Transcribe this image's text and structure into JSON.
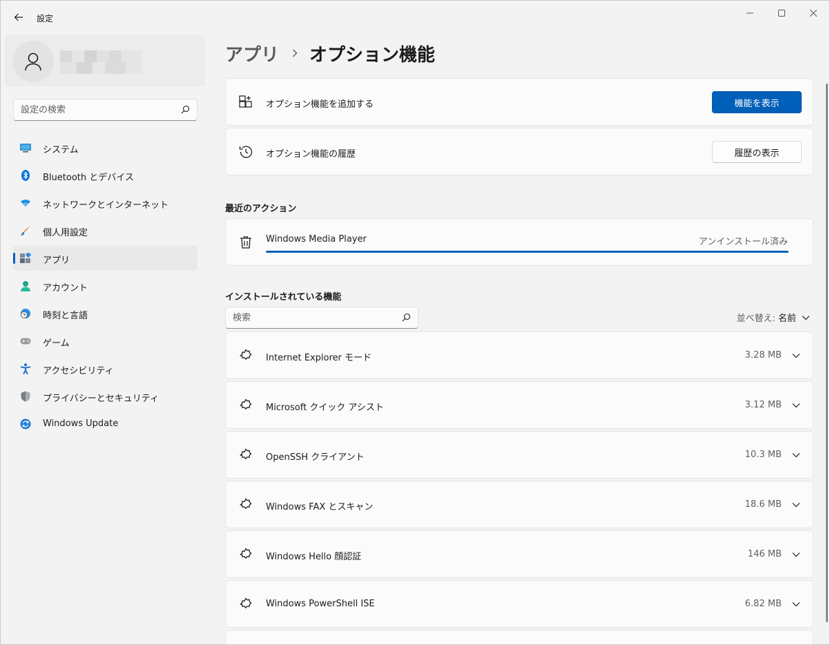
{
  "window": {
    "app_title": "設定"
  },
  "sidebar": {
    "search_placeholder": "設定の検索",
    "items": [
      {
        "label": "システム",
        "icon": "display-icon",
        "active": false
      },
      {
        "label": "Bluetooth とデバイス",
        "icon": "bluetooth-icon",
        "active": false
      },
      {
        "label": "ネットワークとインターネット",
        "icon": "wifi-icon",
        "active": false
      },
      {
        "label": "個人用設定",
        "icon": "brush-icon",
        "active": false
      },
      {
        "label": "アプリ",
        "icon": "apps-icon",
        "active": true
      },
      {
        "label": "アカウント",
        "icon": "person-icon",
        "active": false
      },
      {
        "label": "時刻と言語",
        "icon": "globe-clock-icon",
        "active": false
      },
      {
        "label": "ゲーム",
        "icon": "gamepad-icon",
        "active": false
      },
      {
        "label": "アクセシビリティ",
        "icon": "accessibility-icon",
        "active": false
      },
      {
        "label": "プライバシーとセキュリティ",
        "icon": "shield-icon",
        "active": false
      },
      {
        "label": "Windows Update",
        "icon": "update-icon",
        "active": false
      }
    ]
  },
  "breadcrumb": {
    "parent": "アプリ",
    "current": "オプション機能"
  },
  "add_feature": {
    "label": "オプション機能を追加する",
    "button": "機能を表示"
  },
  "history": {
    "label": "オプション機能の履歴",
    "button": "履歴の表示"
  },
  "recent_actions": {
    "title": "最近のアクション",
    "item": {
      "name": "Windows Media Player",
      "status": "アンインストール済み",
      "progress": 1.0
    }
  },
  "installed": {
    "title": "インストールされている機能",
    "search_placeholder": "検索",
    "sort_label": "並べ替え:",
    "sort_value": "名前",
    "features": [
      {
        "name": "Internet Explorer モード",
        "size": "3.28 MB"
      },
      {
        "name": "Microsoft クイック アシスト",
        "size": "3.12 MB"
      },
      {
        "name": "OpenSSH クライアント",
        "size": "10.3 MB"
      },
      {
        "name": "Windows FAX とスキャン",
        "size": "18.6 MB"
      },
      {
        "name": "Windows Hello 顔認証",
        "size": "146 MB"
      },
      {
        "name": "Windows PowerShell ISE",
        "size": "6.82 MB"
      }
    ]
  },
  "colors": {
    "accent": "#005fb8",
    "background": "#f3f3f3",
    "card": "#fbfbfb"
  }
}
